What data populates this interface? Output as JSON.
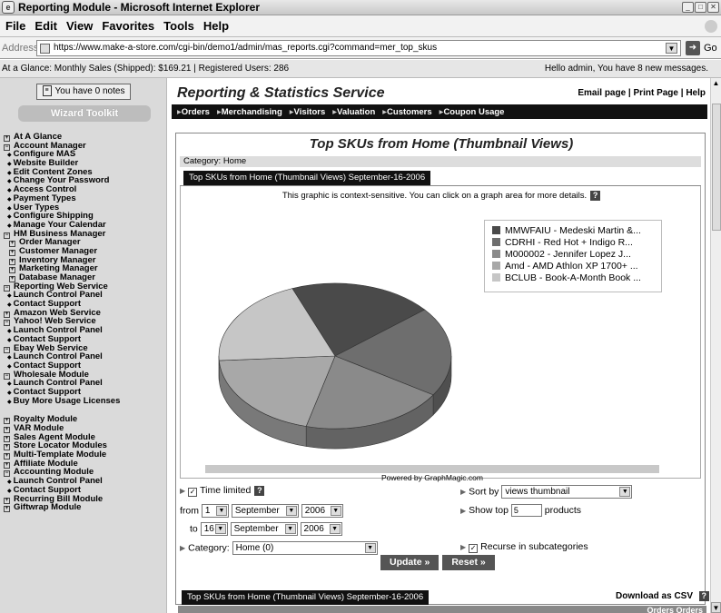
{
  "window": {
    "title": "Reporting Module - Microsoft Internet Explorer"
  },
  "menu": [
    "File",
    "Edit",
    "View",
    "Favorites",
    "Tools",
    "Help"
  ],
  "address": {
    "label": "Address",
    "url": "https://www.make-a-store.com/cgi-bin/demo1/admin/mas_reports.cgi?command=mer_top_skus",
    "go": "Go"
  },
  "status": {
    "glance": "At a Glance: Monthly Sales (Shipped): $169.21 | Registered Users: 286",
    "hello": "Hello admin, You have 8 new messages."
  },
  "sidebar": {
    "notes": "You have 0 notes",
    "wizard": "Wizard Toolkit",
    "items": [
      {
        "label": "At A Glance",
        "kind": "top",
        "box": "+"
      },
      {
        "label": "Account Manager",
        "kind": "top",
        "box": "−"
      },
      {
        "label": "Configure MAS",
        "kind": "child"
      },
      {
        "label": "Website Builder",
        "kind": "child"
      },
      {
        "label": "Edit Content Zones",
        "kind": "child"
      },
      {
        "label": "Change Your Password",
        "kind": "child"
      },
      {
        "label": "Access Control",
        "kind": "child"
      },
      {
        "label": "Payment Types",
        "kind": "child"
      },
      {
        "label": "User Types",
        "kind": "child"
      },
      {
        "label": "Configure Shipping",
        "kind": "child"
      },
      {
        "label": "Manage Your Calendar",
        "kind": "child"
      },
      {
        "label": "HM Business Manager",
        "kind": "top",
        "box": "−"
      },
      {
        "label": "Order Manager",
        "kind": "sub",
        "box": "+"
      },
      {
        "label": "Customer Manager",
        "kind": "sub",
        "box": "+"
      },
      {
        "label": "Inventory Manager",
        "kind": "sub",
        "box": "+"
      },
      {
        "label": "Marketing Manager",
        "kind": "sub",
        "box": "+"
      },
      {
        "label": "Database Manager",
        "kind": "sub",
        "box": "+"
      },
      {
        "label": "Reporting Web Service",
        "kind": "top",
        "box": "−"
      },
      {
        "label": "Launch Control Panel",
        "kind": "child"
      },
      {
        "label": "Contact Support",
        "kind": "child"
      },
      {
        "label": "Amazon Web Service",
        "kind": "top",
        "box": "+"
      },
      {
        "label": "Yahoo! Web Service",
        "kind": "top",
        "box": "−"
      },
      {
        "label": "Launch Control Panel",
        "kind": "child"
      },
      {
        "label": "Contact Support",
        "kind": "child"
      },
      {
        "label": "Ebay Web Service",
        "kind": "top",
        "box": "−"
      },
      {
        "label": "Launch Control Panel",
        "kind": "child"
      },
      {
        "label": "Contact Support",
        "kind": "child"
      },
      {
        "label": "Wholesale Module",
        "kind": "top",
        "box": "−"
      },
      {
        "label": "Launch Control Panel",
        "kind": "child"
      },
      {
        "label": "Contact Support",
        "kind": "child"
      },
      {
        "label": "Buy More Usage Licenses",
        "kind": "child"
      },
      {
        "label": "",
        "kind": "gap"
      },
      {
        "label": "Royalty Module",
        "kind": "top",
        "box": "+"
      },
      {
        "label": "VAR Module",
        "kind": "top",
        "box": "+"
      },
      {
        "label": "Sales Agent Module",
        "kind": "top",
        "box": "+"
      },
      {
        "label": "Store Locator Modules",
        "kind": "top",
        "box": "+"
      },
      {
        "label": "Multi-Template Module",
        "kind": "top",
        "box": "+"
      },
      {
        "label": "Affiliate Module",
        "kind": "top",
        "box": "+"
      },
      {
        "label": "Accounting Module",
        "kind": "top",
        "box": "−"
      },
      {
        "label": "Launch Control Panel",
        "kind": "child"
      },
      {
        "label": "Contact Support",
        "kind": "child"
      },
      {
        "label": "Recurring Bill Module",
        "kind": "top",
        "box": "+"
      },
      {
        "label": "Giftwrap Module",
        "kind": "top",
        "box": "+"
      }
    ]
  },
  "main": {
    "service_title": "Reporting & Statistics Service",
    "top_links": "Email page | Print Page | Help",
    "nav": [
      "Orders",
      "Merchandising",
      "Visitors",
      "Valuation",
      "Customers",
      "Coupon Usage"
    ],
    "page_title": "Top SKUs from Home (Thumbnail Views)",
    "category_line": "Category: Home",
    "tab": "Top SKUs from Home (Thumbnail Views) September-16-2006",
    "sensitive_note": "This graphic is context-sensitive. You can click on a graph area for more details.",
    "powered": "Powered by GraphMagic.com",
    "controls": {
      "time_limited": "Time limited",
      "from": "from",
      "to": "to",
      "from_day": "1",
      "from_month": "September",
      "from_year": "2006",
      "to_day": "16",
      "to_month": "September",
      "to_year": "2006",
      "category_label": "Category:",
      "category_value": "Home (0)",
      "sort_label": "Sort by",
      "sort_value": "views thumbnail",
      "show_top_label": "Show top",
      "show_top_value": "5",
      "products": "products",
      "recurse": "Recurse in subcategories",
      "update": "Update »",
      "reset": "Reset »"
    },
    "bottom_tab": "Top SKUs from Home (Thumbnail Views) September-16-2006",
    "download_csv": "Download as CSV",
    "columns_hint": "Orders  Orders"
  },
  "chart_data": {
    "type": "pie",
    "title": "",
    "legend_position": "top-right",
    "labels": [
      "MMWFAIU - Medeski Martin &...",
      "CDRHI - Red Hot + Indigo R...",
      "M000002 - Jennifer Lopez J...",
      "Amd - AMD Athlon XP 1700+ ...",
      "BCLUB - Book-A-Month Book ..."
    ],
    "values": [
      20,
      20,
      20,
      20,
      20
    ],
    "colors": [
      "#4a4a4a",
      "#6e6e6e",
      "#8a8a8a",
      "#a8a8a8",
      "#c6c6c6"
    ]
  }
}
